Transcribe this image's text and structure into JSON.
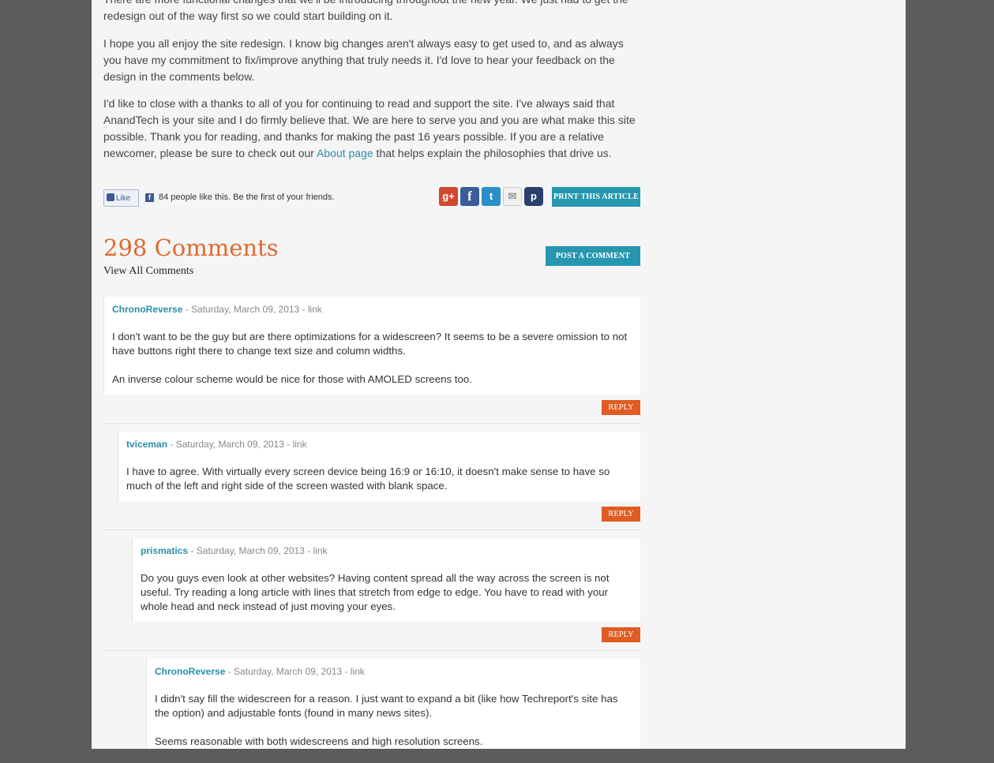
{
  "article": {
    "p1": "There are more functional changes that we'll be introducing throughout the new year. We just had to get the redesign out of the way first so we could start building on it.",
    "p2": "I hope you all enjoy the site redesign. I know big changes aren't always easy to get used to, and as always you have my commitment to fix/improve anything that truly needs it. I'd love to hear your feedback on the design in the comments below.",
    "p3_before": "I'd like to close with a thanks to all of you for continuing to read and support the site. I've always said that AnandTech is your site and I do firmly believe that. We are here to serve you and you are what make this site possible. Thank you for reading, and thanks for making the past 16 years possible. If you are a relative newcomer, please be sure to check out our ",
    "p3_link": "About page",
    "p3_after": " that helps explain the philosophies that drive us."
  },
  "social": {
    "like_label": "Like",
    "fb_icon": "f",
    "like_text": "84 people like this. Be the first of your friends.",
    "share_icons": [
      "google-plus-icon",
      "facebook-icon",
      "twitter-icon",
      "email-icon",
      "pinterest-icon"
    ],
    "google_glyph": "g+",
    "facebook_glyph": "f",
    "twitter_glyph": "t",
    "email_glyph": "✉",
    "pinterest_glyph": "p",
    "print_label": "PRINT THIS ARTICLE"
  },
  "comments_section": {
    "title": "298 Comments",
    "view_all": "View All Comments",
    "post_label": "POST A COMMENT"
  },
  "comments": [
    {
      "author": "ChronoReverse",
      "meta": " - Saturday, March 09, 2013 - link",
      "body": [
        "I don't want to be the guy but are there optimizations for a widescreen? It seems to be a severe omission to not have buttons right there to change text size and column widths.",
        "An inverse colour scheme would be nice for those with AMOLED screens too."
      ],
      "reply": "REPLY"
    },
    {
      "author": "tviceman",
      "meta": " - Saturday, March 09, 2013 - link",
      "body": [
        "I have to agree. With virtually every screen device being 16:9 or 16:10, it doesn't make sense to have so much of the left and right side of the screen wasted with blank space."
      ],
      "reply": "REPLY"
    },
    {
      "author": "prismatics",
      "meta": " - Saturday, March 09, 2013 - link",
      "body": [
        "Do you guys even look at other websites? Having content spread all the way across the screen is not useful. Try reading a long article with lines that stretch from edge to edge. You have to read with your whole head and neck instead of just moving your eyes."
      ],
      "reply": "REPLY"
    },
    {
      "author": "ChronoReverse",
      "meta": " - Saturday, March 09, 2013 - link",
      "body": [
        "I didn't say fill the widescreen for a reason. I just want to expand a bit (like how Techreport's site has the option) and adjustable fonts (found in many news sites).",
        "Seems reasonable with both widescreens and high resolution screens."
      ]
    }
  ],
  "colors": {
    "accent_orange": "#e0692e",
    "teal": "#2797b0",
    "reply_orange": "#e05c22",
    "background": "#5c5c5c",
    "page": "#f5f5f5"
  }
}
